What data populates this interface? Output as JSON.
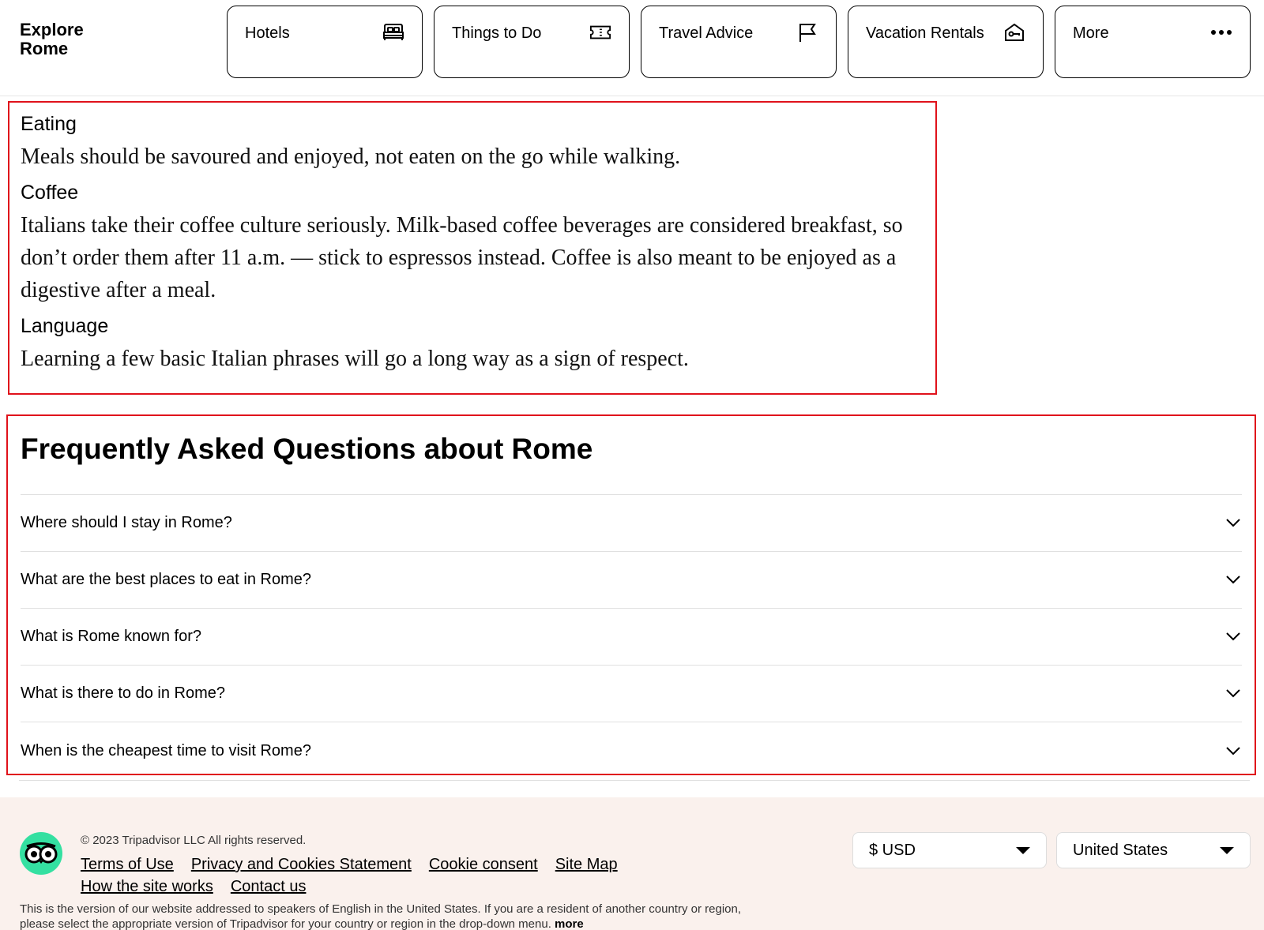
{
  "brand": {
    "line1": "Explore",
    "line2": "Rome"
  },
  "nav": [
    {
      "label": "Hotels",
      "icon": "bed-icon"
    },
    {
      "label": "Things to Do",
      "icon": "ticket-icon"
    },
    {
      "label": "Travel Advice",
      "icon": "flag-icon"
    },
    {
      "label": "Vacation Rentals",
      "icon": "house-key-icon"
    },
    {
      "label": "More",
      "icon": "more-dots-icon"
    }
  ],
  "etiquette": [
    {
      "heading": "Eating",
      "text": "Meals should be savoured and enjoyed, not eaten on the go while walking."
    },
    {
      "heading": "Coffee",
      "text": "Italians take their coffee culture seriously. Milk-based coffee beverages are considered breakfast, so don’t order them after 11 a.m. — stick to espressos instead. Coffee is also meant to be enjoyed as a digestive after a meal."
    },
    {
      "heading": "Language",
      "text": "Learning a few basic Italian phrases will go a long way as a sign of respect."
    }
  ],
  "faq": {
    "title": "Frequently Asked Questions about Rome",
    "questions": [
      "Where should I stay in Rome?",
      "What are the best places to eat in Rome?",
      "What is Rome known for?",
      "What is there to do in Rome?",
      "When is the cheapest time to visit Rome?"
    ]
  },
  "footer": {
    "copyright": "© 2023 Tripadvisor LLC All rights reserved.",
    "links": [
      "Terms of Use",
      "Privacy and Cookies Statement",
      "Cookie consent",
      "Site Map",
      "How the site works",
      "Contact us"
    ],
    "disclaimer_line1": "This is the version of our website addressed to speakers of English in the United States. If you are a resident of another country or region,",
    "disclaimer_line2": "please select the appropriate version of Tripadvisor for your country or region in the drop-down menu.",
    "more_label": "more",
    "currency": "$ USD",
    "country": "United States"
  },
  "colors": {
    "highlight_border": "#e0121b",
    "footer_bg": "#faf1ed",
    "logo_green": "#34e0a1"
  }
}
